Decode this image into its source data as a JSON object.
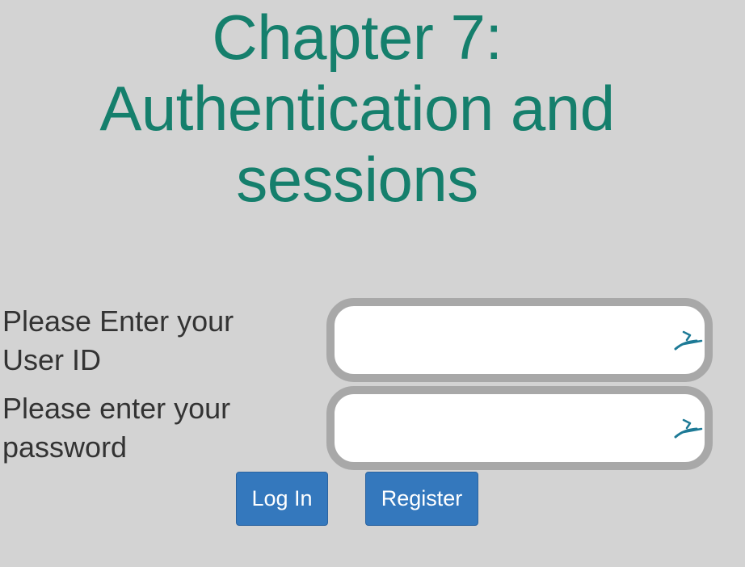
{
  "page": {
    "title_lines": [
      "Chapter 7:",
      "Authentication and",
      "sessions"
    ]
  },
  "form": {
    "user_id": {
      "label": "Please Enter your User ID",
      "value": "",
      "icon": "keychain-autofill-icon"
    },
    "password": {
      "label": "Please enter your password",
      "value": "",
      "icon": "keychain-autofill-icon"
    },
    "buttons": {
      "login_label": "Log In",
      "register_label": "Register"
    }
  },
  "colors": {
    "background": "#d3d3d3",
    "title": "#157f6c",
    "button": "#3478bd",
    "field_border": "#a8a8a8",
    "label_text": "#333333",
    "icon": "#1d7a96"
  }
}
